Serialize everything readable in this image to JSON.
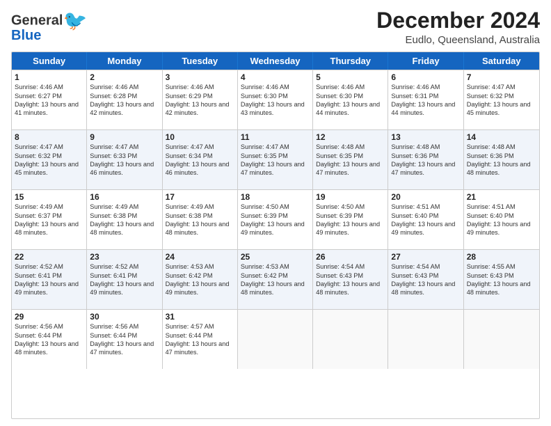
{
  "logo": {
    "line1": "General",
    "line2": "Blue"
  },
  "title": "December 2024",
  "location": "Eudlo, Queensland, Australia",
  "days_of_week": [
    "Sunday",
    "Monday",
    "Tuesday",
    "Wednesday",
    "Thursday",
    "Friday",
    "Saturday"
  ],
  "weeks": [
    [
      {
        "day": "1",
        "rise": "Sunrise: 4:46 AM",
        "set": "Sunset: 6:27 PM",
        "daylight": "Daylight: 13 hours and 41 minutes."
      },
      {
        "day": "2",
        "rise": "Sunrise: 4:46 AM",
        "set": "Sunset: 6:28 PM",
        "daylight": "Daylight: 13 hours and 42 minutes."
      },
      {
        "day": "3",
        "rise": "Sunrise: 4:46 AM",
        "set": "Sunset: 6:29 PM",
        "daylight": "Daylight: 13 hours and 42 minutes."
      },
      {
        "day": "4",
        "rise": "Sunrise: 4:46 AM",
        "set": "Sunset: 6:30 PM",
        "daylight": "Daylight: 13 hours and 43 minutes."
      },
      {
        "day": "5",
        "rise": "Sunrise: 4:46 AM",
        "set": "Sunset: 6:30 PM",
        "daylight": "Daylight: 13 hours and 44 minutes."
      },
      {
        "day": "6",
        "rise": "Sunrise: 4:46 AM",
        "set": "Sunset: 6:31 PM",
        "daylight": "Daylight: 13 hours and 44 minutes."
      },
      {
        "day": "7",
        "rise": "Sunrise: 4:47 AM",
        "set": "Sunset: 6:32 PM",
        "daylight": "Daylight: 13 hours and 45 minutes."
      }
    ],
    [
      {
        "day": "8",
        "rise": "Sunrise: 4:47 AM",
        "set": "Sunset: 6:32 PM",
        "daylight": "Daylight: 13 hours and 45 minutes."
      },
      {
        "day": "9",
        "rise": "Sunrise: 4:47 AM",
        "set": "Sunset: 6:33 PM",
        "daylight": "Daylight: 13 hours and 46 minutes."
      },
      {
        "day": "10",
        "rise": "Sunrise: 4:47 AM",
        "set": "Sunset: 6:34 PM",
        "daylight": "Daylight: 13 hours and 46 minutes."
      },
      {
        "day": "11",
        "rise": "Sunrise: 4:47 AM",
        "set": "Sunset: 6:35 PM",
        "daylight": "Daylight: 13 hours and 47 minutes."
      },
      {
        "day": "12",
        "rise": "Sunrise: 4:48 AM",
        "set": "Sunset: 6:35 PM",
        "daylight": "Daylight: 13 hours and 47 minutes."
      },
      {
        "day": "13",
        "rise": "Sunrise: 4:48 AM",
        "set": "Sunset: 6:36 PM",
        "daylight": "Daylight: 13 hours and 47 minutes."
      },
      {
        "day": "14",
        "rise": "Sunrise: 4:48 AM",
        "set": "Sunset: 6:36 PM",
        "daylight": "Daylight: 13 hours and 48 minutes."
      }
    ],
    [
      {
        "day": "15",
        "rise": "Sunrise: 4:49 AM",
        "set": "Sunset: 6:37 PM",
        "daylight": "Daylight: 13 hours and 48 minutes."
      },
      {
        "day": "16",
        "rise": "Sunrise: 4:49 AM",
        "set": "Sunset: 6:38 PM",
        "daylight": "Daylight: 13 hours and 48 minutes."
      },
      {
        "day": "17",
        "rise": "Sunrise: 4:49 AM",
        "set": "Sunset: 6:38 PM",
        "daylight": "Daylight: 13 hours and 48 minutes."
      },
      {
        "day": "18",
        "rise": "Sunrise: 4:50 AM",
        "set": "Sunset: 6:39 PM",
        "daylight": "Daylight: 13 hours and 49 minutes."
      },
      {
        "day": "19",
        "rise": "Sunrise: 4:50 AM",
        "set": "Sunset: 6:39 PM",
        "daylight": "Daylight: 13 hours and 49 minutes."
      },
      {
        "day": "20",
        "rise": "Sunrise: 4:51 AM",
        "set": "Sunset: 6:40 PM",
        "daylight": "Daylight: 13 hours and 49 minutes."
      },
      {
        "day": "21",
        "rise": "Sunrise: 4:51 AM",
        "set": "Sunset: 6:40 PM",
        "daylight": "Daylight: 13 hours and 49 minutes."
      }
    ],
    [
      {
        "day": "22",
        "rise": "Sunrise: 4:52 AM",
        "set": "Sunset: 6:41 PM",
        "daylight": "Daylight: 13 hours and 49 minutes."
      },
      {
        "day": "23",
        "rise": "Sunrise: 4:52 AM",
        "set": "Sunset: 6:41 PM",
        "daylight": "Daylight: 13 hours and 49 minutes."
      },
      {
        "day": "24",
        "rise": "Sunrise: 4:53 AM",
        "set": "Sunset: 6:42 PM",
        "daylight": "Daylight: 13 hours and 49 minutes."
      },
      {
        "day": "25",
        "rise": "Sunrise: 4:53 AM",
        "set": "Sunset: 6:42 PM",
        "daylight": "Daylight: 13 hours and 48 minutes."
      },
      {
        "day": "26",
        "rise": "Sunrise: 4:54 AM",
        "set": "Sunset: 6:43 PM",
        "daylight": "Daylight: 13 hours and 48 minutes."
      },
      {
        "day": "27",
        "rise": "Sunrise: 4:54 AM",
        "set": "Sunset: 6:43 PM",
        "daylight": "Daylight: 13 hours and 48 minutes."
      },
      {
        "day": "28",
        "rise": "Sunrise: 4:55 AM",
        "set": "Sunset: 6:43 PM",
        "daylight": "Daylight: 13 hours and 48 minutes."
      }
    ],
    [
      {
        "day": "29",
        "rise": "Sunrise: 4:56 AM",
        "set": "Sunset: 6:44 PM",
        "daylight": "Daylight: 13 hours and 48 minutes."
      },
      {
        "day": "30",
        "rise": "Sunrise: 4:56 AM",
        "set": "Sunset: 6:44 PM",
        "daylight": "Daylight: 13 hours and 47 minutes."
      },
      {
        "day": "31",
        "rise": "Sunrise: 4:57 AM",
        "set": "Sunset: 6:44 PM",
        "daylight": "Daylight: 13 hours and 47 minutes."
      },
      null,
      null,
      null,
      null
    ]
  ]
}
